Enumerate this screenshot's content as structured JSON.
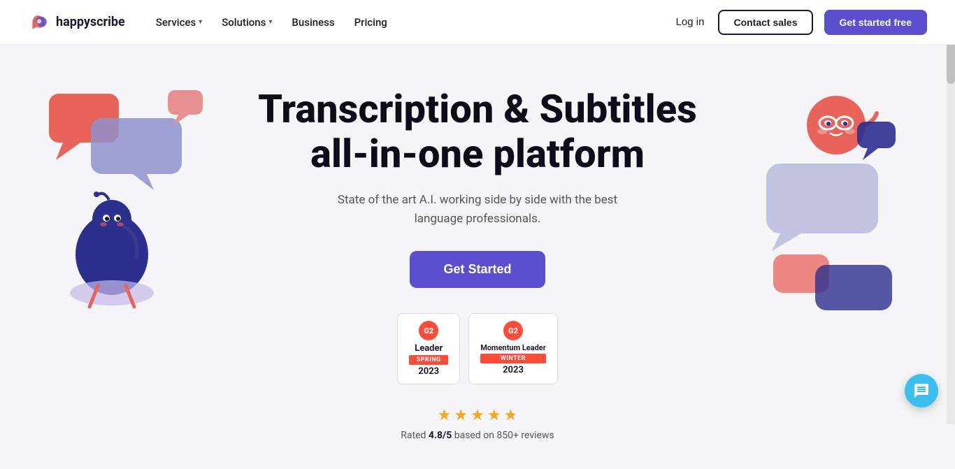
{
  "brand": {
    "name": "happyscribe",
    "logo_alt": "HappyScribe logo"
  },
  "nav": {
    "links": [
      {
        "label": "Services",
        "has_dropdown": true
      },
      {
        "label": "Solutions",
        "has_dropdown": true
      },
      {
        "label": "Business",
        "has_dropdown": false
      },
      {
        "label": "Pricing",
        "has_dropdown": false
      }
    ],
    "login_label": "Log in",
    "contact_label": "Contact sales",
    "get_started_label": "Get started free"
  },
  "hero": {
    "title": "Transcription & Subtitles all-in-one platform",
    "subtitle": "State of the art A.I. working side by side with the best language professionals.",
    "cta_label": "Get Started",
    "badges": [
      {
        "g2_label": "G2",
        "title": "Leader",
        "stripe": "SPRING",
        "year": "2023"
      },
      {
        "g2_label": "G2",
        "title": "Momentum Leader",
        "stripe": "WINTER",
        "year": "2023"
      }
    ],
    "stars_count": 4.8,
    "stars_display": "★★★★★",
    "rating_text": "Rated ",
    "rating_value": "4.8/5",
    "rating_suffix": " based on 850+ reviews"
  },
  "colors": {
    "accent": "#5b4fcf",
    "accent_light": "#7b6fef",
    "coral": "#e8635a",
    "navy": "#2d2f8f",
    "lavender": "#8f90cc",
    "light_purple": "#c4b8e8",
    "pink": "#e89090",
    "teal": "#3bbfef"
  }
}
